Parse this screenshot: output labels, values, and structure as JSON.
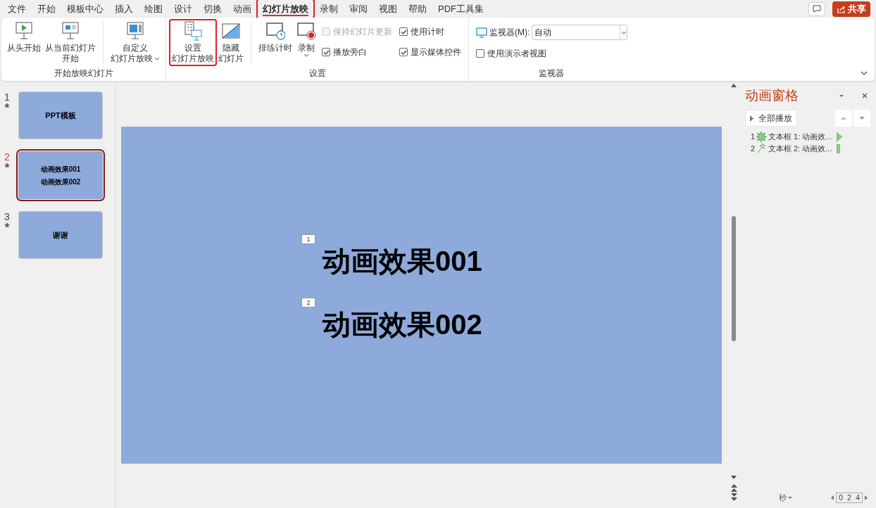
{
  "menu_tabs": [
    {
      "label": "文件",
      "selected": false,
      "highlighted": false
    },
    {
      "label": "开始",
      "selected": false,
      "highlighted": false
    },
    {
      "label": "模板中心",
      "selected": false,
      "highlighted": false
    },
    {
      "label": "插入",
      "selected": false,
      "highlighted": false
    },
    {
      "label": "绘图",
      "selected": false,
      "highlighted": false
    },
    {
      "label": "设计",
      "selected": false,
      "highlighted": false
    },
    {
      "label": "切换",
      "selected": false,
      "highlighted": false
    },
    {
      "label": "动画",
      "selected": false,
      "highlighted": false
    },
    {
      "label": "幻灯片放映",
      "selected": true,
      "highlighted": true
    },
    {
      "label": "录制",
      "selected": false,
      "highlighted": false
    },
    {
      "label": "审阅",
      "selected": false,
      "highlighted": false
    },
    {
      "label": "视图",
      "selected": false,
      "highlighted": false
    },
    {
      "label": "帮助",
      "selected": false,
      "highlighted": false
    },
    {
      "label": "PDF工具集",
      "selected": false,
      "highlighted": false
    }
  ],
  "share_button": "共享",
  "ribbon_groups": [
    {
      "label": "开始放映幻灯片",
      "items": [
        {
          "kind": "button",
          "lines": [
            "从头开始"
          ],
          "dropdown": false,
          "highlighted": false
        },
        {
          "kind": "button",
          "lines": [
            "从当前幻灯片",
            "开始"
          ],
          "dropdown": false,
          "highlighted": false
        },
        {
          "kind": "separator"
        },
        {
          "kind": "button",
          "lines": [
            "自定义",
            "幻灯片放映"
          ],
          "dropdown": true,
          "highlighted": false
        }
      ]
    },
    {
      "label": "设置",
      "items": [
        {
          "kind": "button",
          "lines": [
            "设置",
            "幻灯片放映"
          ],
          "dropdown": false,
          "highlighted": true
        },
        {
          "kind": "button",
          "lines": [
            "隐藏",
            "幻灯片"
          ],
          "dropdown": false,
          "highlighted": false
        },
        {
          "kind": "separator"
        },
        {
          "kind": "button",
          "lines": [
            "排练计时"
          ],
          "dropdown": false,
          "highlighted": false
        },
        {
          "kind": "button",
          "lines": [
            "录制"
          ],
          "dropdown": true,
          "highlighted": false
        },
        {
          "kind": "checks",
          "boxes": [
            {
              "label": "保持幻灯片更新",
              "checked": false,
              "disabled": true
            },
            {
              "label": "播放旁白",
              "checked": true,
              "disabled": false
            }
          ]
        },
        {
          "kind": "checks",
          "boxes": [
            {
              "label": "使用计时",
              "checked": true,
              "disabled": false
            },
            {
              "label": "显示媒体控件",
              "checked": true,
              "disabled": false
            }
          ]
        }
      ]
    },
    {
      "label": "监视器",
      "items": [
        {
          "kind": "monitor",
          "label": "监视器(M):",
          "value": "自动",
          "boxes": [
            {
              "label": "使用演示者视图",
              "checked": false,
              "disabled": false
            }
          ]
        }
      ]
    }
  ],
  "slides": [
    {
      "number": "1",
      "lines": [
        "PPT模板"
      ],
      "selected": false,
      "animated": true
    },
    {
      "number": "2",
      "lines": [
        "动画效果001",
        "动画效果002"
      ],
      "selected": true,
      "animated": true
    },
    {
      "number": "3",
      "lines": [
        "谢谢"
      ],
      "selected": false,
      "animated": true
    }
  ],
  "current_slide": {
    "items": [
      {
        "tag": "1",
        "text": "动画效果001"
      },
      {
        "tag": "2",
        "text": "动画效果002"
      }
    ]
  },
  "animation_pane": {
    "title": "动画窗格",
    "play_all": "全部播放",
    "items": [
      {
        "number": "1",
        "label": "文本框 1: 动画效...",
        "kind": "burst"
      },
      {
        "number": "2",
        "label": "文本框 2: 动画效...",
        "kind": "sparkle"
      }
    ],
    "unit": "秒",
    "ticks": [
      "0",
      "2",
      "4"
    ]
  }
}
